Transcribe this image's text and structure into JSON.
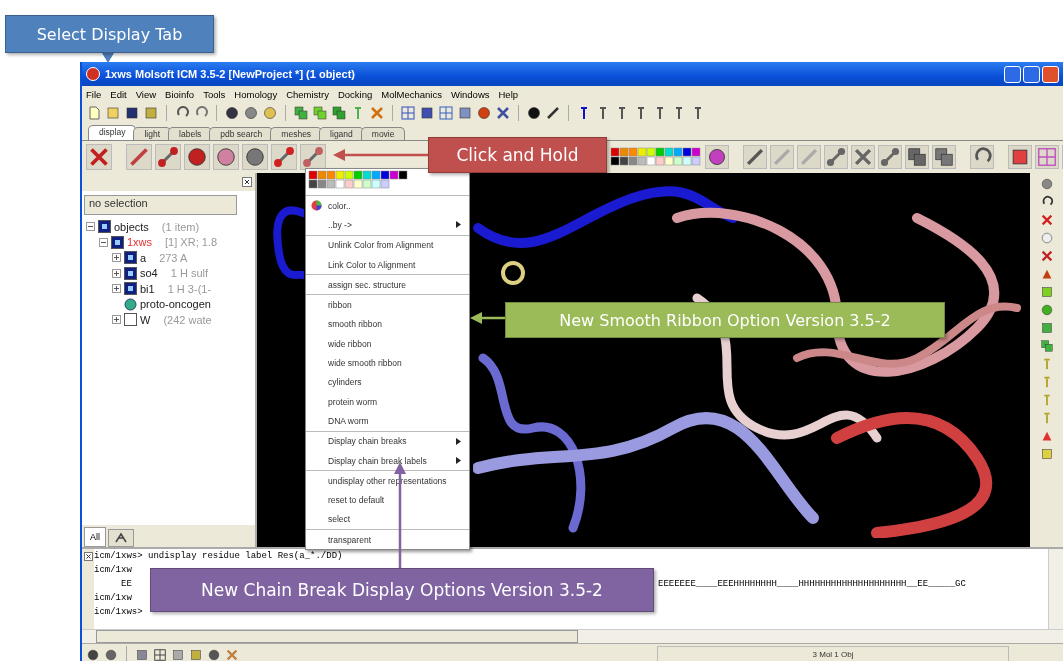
{
  "callouts": [
    {
      "text": "Select Display Tab",
      "color": "#4f81bd"
    },
    {
      "text": "Click and Hold",
      "color": "#c0504d"
    },
    {
      "text": "New Smooth Ribbon Option Version 3.5-2",
      "color": "#9bbb59"
    },
    {
      "text": "New Chain Break Display Options Version 3.5-2",
      "color": "#8064a2"
    }
  ],
  "window": {
    "title": "1xws Molsoft ICM 3.5-2 [NewProject *] (1 object)"
  },
  "menubar": [
    "File",
    "Edit",
    "View",
    "Bioinfo",
    "Tools",
    "Homology",
    "Chemistry",
    "Docking",
    "MolMechanics",
    "Windows",
    "Help"
  ],
  "tabs": [
    {
      "label": "display",
      "selected": true
    },
    {
      "label": "light",
      "selected": false
    },
    {
      "label": "labels",
      "selected": false
    },
    {
      "label": "pdb search",
      "selected": false
    },
    {
      "label": "meshes",
      "selected": false
    },
    {
      "label": "ligand",
      "selected": false
    },
    {
      "label": "movie",
      "selected": false
    }
  ],
  "workspace": {
    "selection": "no selection",
    "tree": [
      {
        "name": "objects",
        "info": "(1 item)",
        "kind": "object",
        "shown": true,
        "current": false,
        "expanded": true,
        "children": [
          {
            "name": "1xws",
            "info": "[1] XR; 1.8",
            "kind": "object",
            "shown": true,
            "current": true,
            "expanded": true,
            "children": [
              {
                "name": "a",
                "info": "273 A",
                "kind": "object",
                "shown": true,
                "current": false,
                "expanded": false
              },
              {
                "name": "so4",
                "info": "1 H  sulf",
                "kind": "object",
                "shown": true,
                "current": false,
                "expanded": false
              },
              {
                "name": "bi1",
                "info": "1 H  3-(1-",
                "kind": "object",
                "shown": true,
                "current": false,
                "expanded": false
              },
              {
                "name": "proto-oncogen",
                "kind": "sequence",
                "current": false
              },
              {
                "name": "W",
                "info": "(242 wate",
                "kind": "object",
                "shown": false,
                "current": false,
                "expanded": false
              }
            ]
          }
        ]
      }
    ],
    "tabs": [
      {
        "kind": "text",
        "label": "All",
        "selected": true
      },
      {
        "kind": "icon",
        "selected": false
      }
    ]
  },
  "context_menu": {
    "groups": [
      [
        {
          "label": "color..",
          "kind": "color",
          "submenu": false
        },
        {
          "label": "..by ->",
          "kind": "command",
          "submenu": true
        }
      ],
      [
        {
          "label": "Unlink Color from Alignment",
          "kind": "command",
          "submenu": false
        },
        {
          "label": "Link Color to Alignment",
          "kind": "command",
          "submenu": false
        }
      ],
      [
        {
          "label": "assign sec. structure",
          "kind": "command",
          "submenu": false
        }
      ],
      [
        {
          "label": "ribbon",
          "kind": "command",
          "submenu": false
        },
        {
          "label": "smooth ribbon",
          "kind": "command",
          "submenu": false
        },
        {
          "label": "wide ribbon",
          "kind": "command",
          "submenu": false
        },
        {
          "label": "wide smooth ribbon",
          "kind": "command",
          "submenu": false
        },
        {
          "label": "cylinders",
          "kind": "command",
          "submenu": false
        },
        {
          "label": "protein worm",
          "kind": "command",
          "submenu": false
        },
        {
          "label": "DNA worm",
          "kind": "command",
          "submenu": false
        }
      ],
      [
        {
          "label": "Display chain breaks",
          "kind": "command",
          "submenu": true
        },
        {
          "label": "Display chain break labels",
          "kind": "command",
          "submenu": true
        }
      ],
      [
        {
          "label": "undisplay other representations",
          "kind": "command",
          "submenu": false
        },
        {
          "label": "reset to default",
          "kind": "command",
          "submenu": false
        },
        {
          "label": "select",
          "kind": "command",
          "submenu": false
        }
      ],
      [
        {
          "label": "transparent",
          "kind": "command",
          "submenu": false
        }
      ]
    ]
  },
  "console": {
    "lines": [
      {
        "left": "icm/1xws> undisplay residue label Res(a_*./DD)"
      },
      {
        "left": "icm/1xw"
      },
      {
        "left": "     EE",
        "right": "EEEEEEE____EEEHHHHHHHH____HHHHHHHHHHHHHHHHHHHH__EE_____GC"
      },
      {
        "left": "icm/1xw"
      },
      {
        "left": "icm/1xws> "
      }
    ]
  },
  "status_bar": {
    "info": "3 Mol 1 Obj"
  }
}
